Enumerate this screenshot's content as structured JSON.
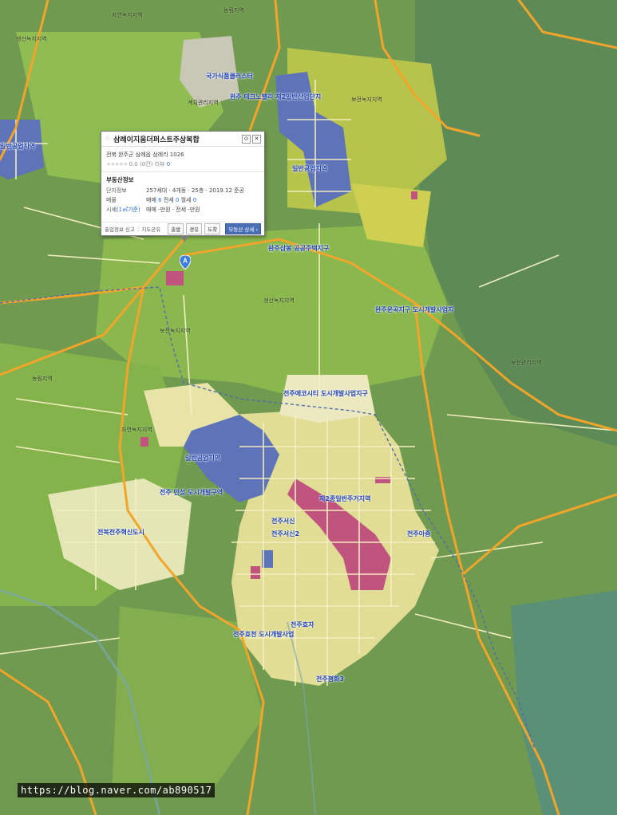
{
  "map": {
    "labels": {
      "l1": "자연녹지지역",
      "l2": "농림지역",
      "l3": "생산녹지지역",
      "l4": "계획관리지역",
      "l5": "보전녹지지역",
      "l6": "보전관리지역",
      "l7": "국가식품클러스터",
      "l8": "일반공업지역",
      "l9": "일반공업지역",
      "l10": "완주삼봉 공공주택지구",
      "l11": "완주운곡지구 도시개발사업지",
      "l12": "전주에코시티 도시개발사업지구",
      "l13": "전주 만성 도시개발구역",
      "l14": "전북전주혁신도시",
      "l15": "제2종일반주거지역",
      "l16": "전주서신",
      "l17": "전주서신2",
      "l18": "전주아중",
      "l19": "전주효자",
      "l20": "전주효천 도시개발사업",
      "l21": "전주평화3",
      "l22": "자연녹지지역",
      "l23": "농림지역",
      "l24": "생산녹지지역",
      "l25": "보전녹지지역",
      "l26": "완주 테크노밸리 제2일반산업단지",
      "l27": "일반공업지역"
    }
  },
  "popup": {
    "title": "삼례이지움더퍼스트주상복합",
    "address": "전북 완주군 삼례읍 삼례리 1026",
    "rating_stars": "★★★★★",
    "rating_score": "0.0 (0건)",
    "review_label": "리뷰",
    "review_count": "0",
    "section_title": "부동산정보",
    "complex_label": "단지정보",
    "complex_value": "257세대 · 4개동 · 25층 · 2019.12 준공",
    "listing_label": "매물",
    "listing_sale": "매매",
    "listing_sale_n": "6",
    "listing_jeonse": "전세",
    "listing_jeonse_n": "0",
    "listing_monthly": "월세",
    "listing_monthly_n": "0",
    "price_label": "시세",
    "price_hint": "(1㎡기준)",
    "price_value": "매매 -만원 · 전세 -만원",
    "foot_report": "출입정보 신고",
    "foot_share": "지도공유",
    "btn_depart": "출발",
    "btn_via": "경유",
    "btn_arrive": "도착",
    "btn_detail": "부동산 상세 ›",
    "close_glyph": "✕",
    "pin_glyph": "⊙"
  },
  "marker": {
    "letter": "A"
  },
  "watermark": "https://blog.naver.com/ab890517",
  "colors": {
    "green": "#6f9a4f",
    "light_green": "#9cc85a",
    "yellow_green": "#c8d04e",
    "residential": "#e8e29a",
    "industrial": "#5f73b8",
    "commercial": "#c0547e",
    "road_major": "#f2a52a",
    "road_minor": "#f4eeb6"
  }
}
